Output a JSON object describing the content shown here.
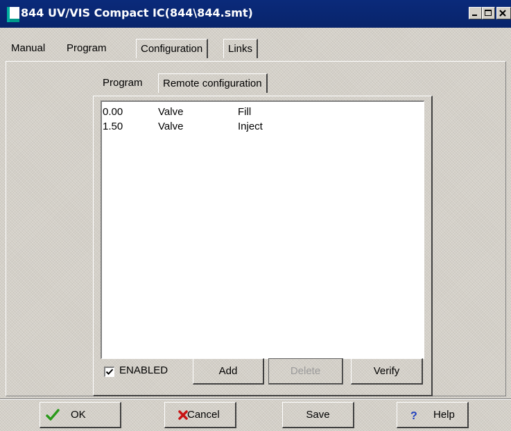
{
  "window": {
    "title": "844 UV/VIS Compact IC(844\\844.smt)",
    "title_bar_color": "#08246b"
  },
  "main_tabs": [
    {
      "label": "Manual"
    },
    {
      "label": "Program"
    },
    {
      "label": "Configuration"
    },
    {
      "label": "Links"
    }
  ],
  "sub_tabs": [
    {
      "label": "Program"
    },
    {
      "label": "Remote configuration"
    }
  ],
  "program_rows": [
    {
      "time": "0.00",
      "device": "Valve",
      "action": "Fill"
    },
    {
      "time": "1.50",
      "device": "Valve",
      "action": "Inject"
    }
  ],
  "controls": {
    "enabled_label": "ENABLED",
    "enabled_checked": true,
    "add_label": "Add",
    "delete_label": "Delete",
    "verify_label": "Verify"
  },
  "footer": {
    "ok_label": "OK",
    "cancel_label": "Cancel",
    "save_label": "Save",
    "help_label": "Help"
  },
  "colors": {
    "dialog_bg": "#d4d0c8",
    "ok_check": "#2a9a1a",
    "cancel_x": "#c81414",
    "help_q": "#1f3fbf"
  }
}
